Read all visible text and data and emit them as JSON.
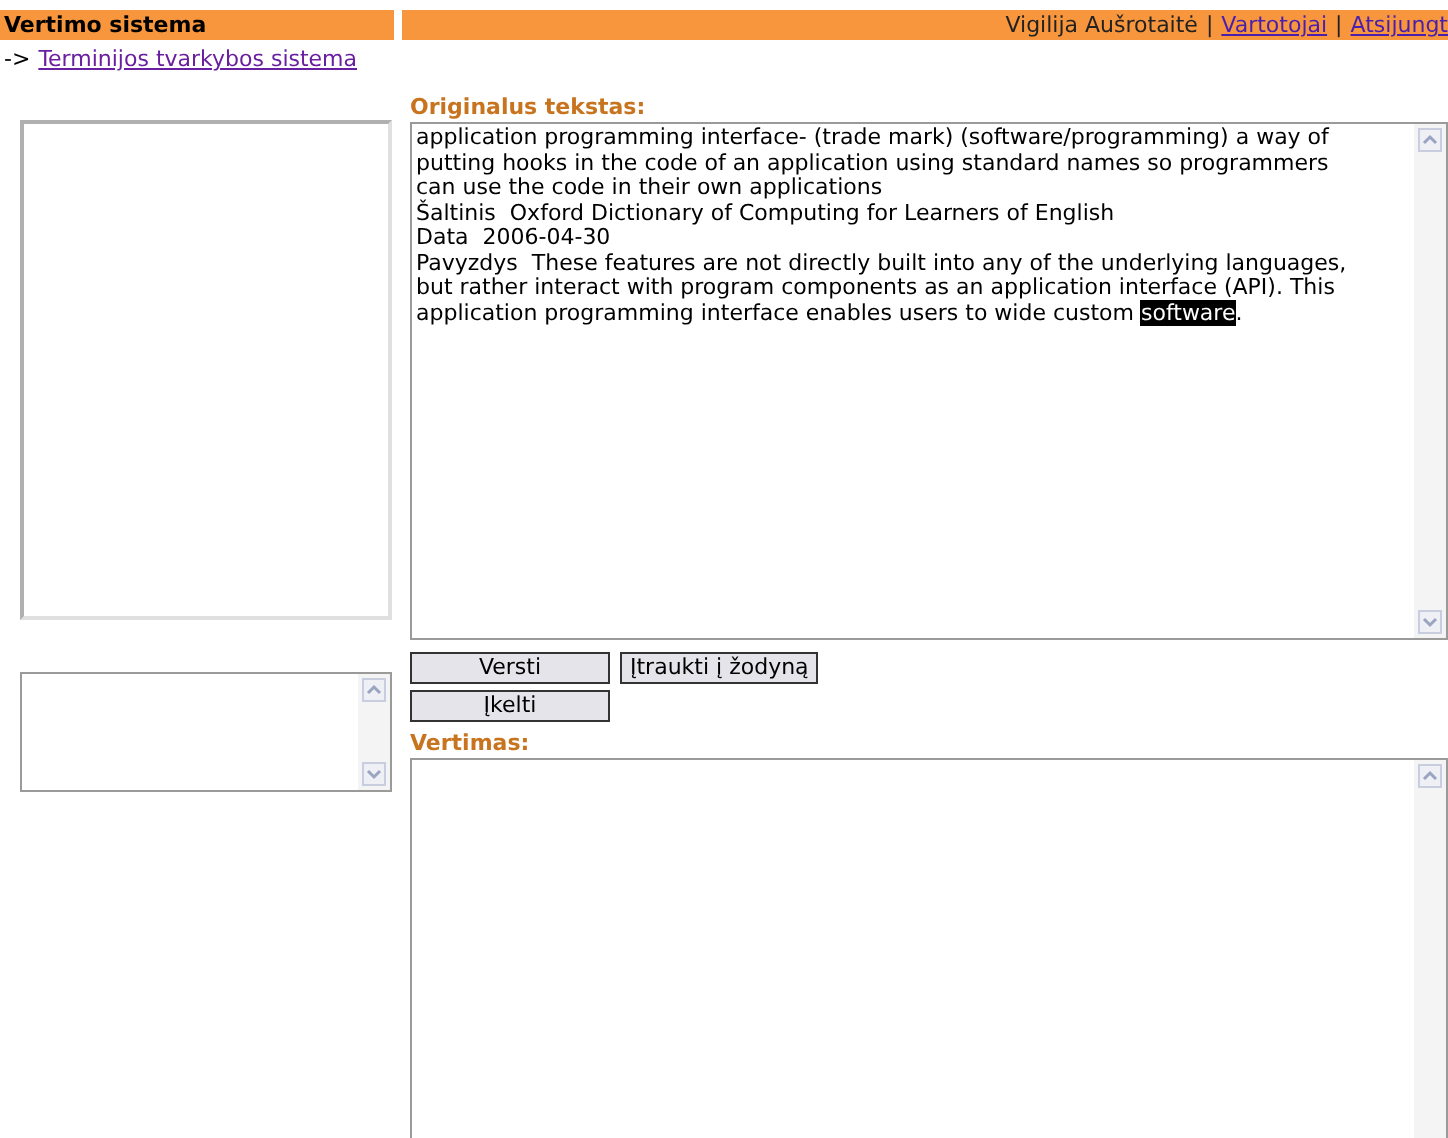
{
  "header": {
    "title": "Vertimo sistema",
    "user": "Vigilija Aušrotaitė",
    "links": [
      "Vartotojai",
      "Atsijungt"
    ],
    "separator": "|"
  },
  "breadcrumb": {
    "arrow": "->",
    "link": "Terminijos tvarkybos sistema"
  },
  "original": {
    "label": "Originalus tekstas:",
    "lines": [
      [
        {
          "text": "application programming interface- (trade mark) (software/programming) a way of",
          "selected": false
        }
      ],
      [
        {
          "text": "putting hooks in the code of an application using standard names so programmers",
          "selected": false
        }
      ],
      [
        {
          "text": "can use the code in their own applications",
          "selected": false
        }
      ],
      [
        {
          "text": "Šaltinis  Oxford Dictionary of Computing for Learners of English",
          "selected": false
        }
      ],
      [
        {
          "text": "Data  2006-04-30",
          "selected": false
        }
      ],
      [
        {
          "text": "Pavyzdys  These features are not directly built into any of the underlying languages,",
          "selected": false
        }
      ],
      [
        {
          "text": "but rather interact with program components as an application interface (API). This",
          "selected": false
        }
      ],
      [
        {
          "text": "application programming interface enables users to wide custom ",
          "selected": false
        },
        {
          "text": "software",
          "selected": true
        },
        {
          "text": ".",
          "selected": false
        }
      ]
    ]
  },
  "buttons": [
    "Versti",
    "Įtraukti į žodyną",
    "Įkelti"
  ],
  "translation": {
    "label": "Vertimas:"
  }
}
